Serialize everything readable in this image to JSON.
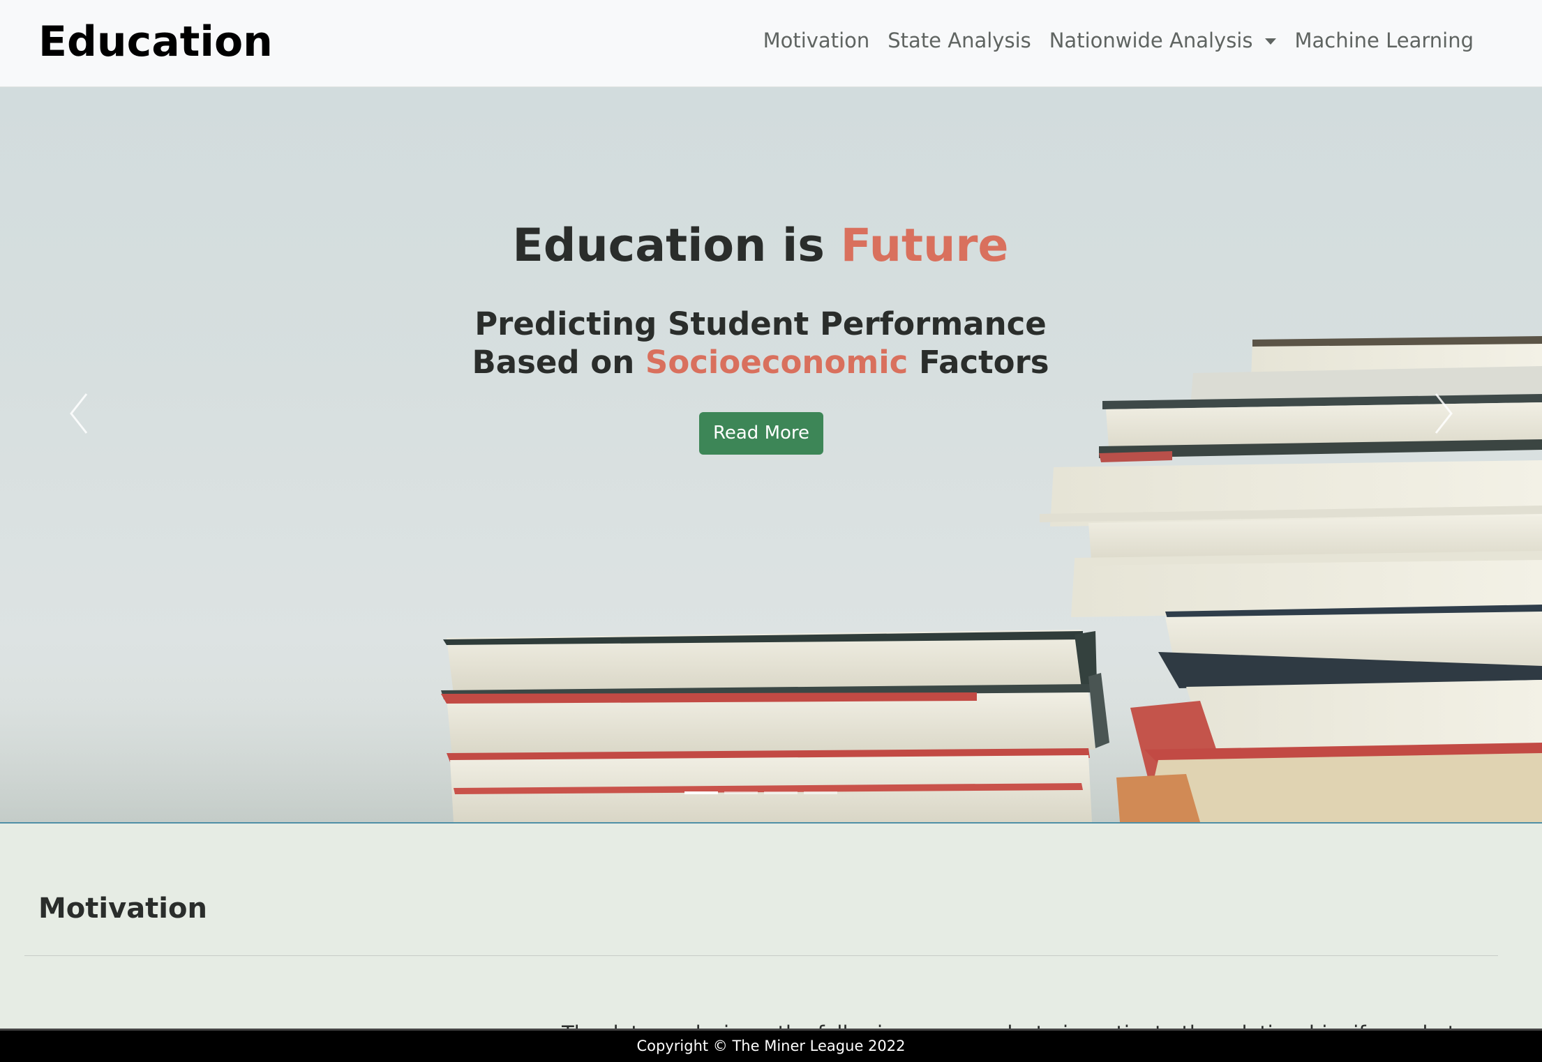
{
  "navbar": {
    "brand": "Education",
    "links": [
      {
        "label": "Motivation"
      },
      {
        "label": "State Analysis"
      },
      {
        "label": "Nationwide Analysis",
        "has_dropdown": true
      },
      {
        "label": "Machine Learning"
      }
    ]
  },
  "hero": {
    "title_part1": "Education is ",
    "title_accent": "Future",
    "subtitle_line1": "Predicting Student Performance",
    "subtitle_line2_part1": "Based on ",
    "subtitle_line2_accent": "Socioeconomic",
    "subtitle_line2_part2": " Factors",
    "cta_label": "Read More",
    "slide_count": 4,
    "active_slide": 0
  },
  "motivation": {
    "title": "Motivation",
    "text_partial": "The data analysis on the following page seeks to investigate the relationship, if any, betw"
  },
  "footer": {
    "copyright": "Copyright © The Miner League 2022"
  },
  "colors": {
    "accent": "#d9705d",
    "button": "#3d8657",
    "navbar_bg": "#f8f9fa",
    "page_bg": "#e6ece4",
    "footer_bg": "#000000"
  },
  "icons": {
    "prev": "chevron-left-icon",
    "next": "chevron-right-icon",
    "dropdown": "caret-down-icon"
  }
}
